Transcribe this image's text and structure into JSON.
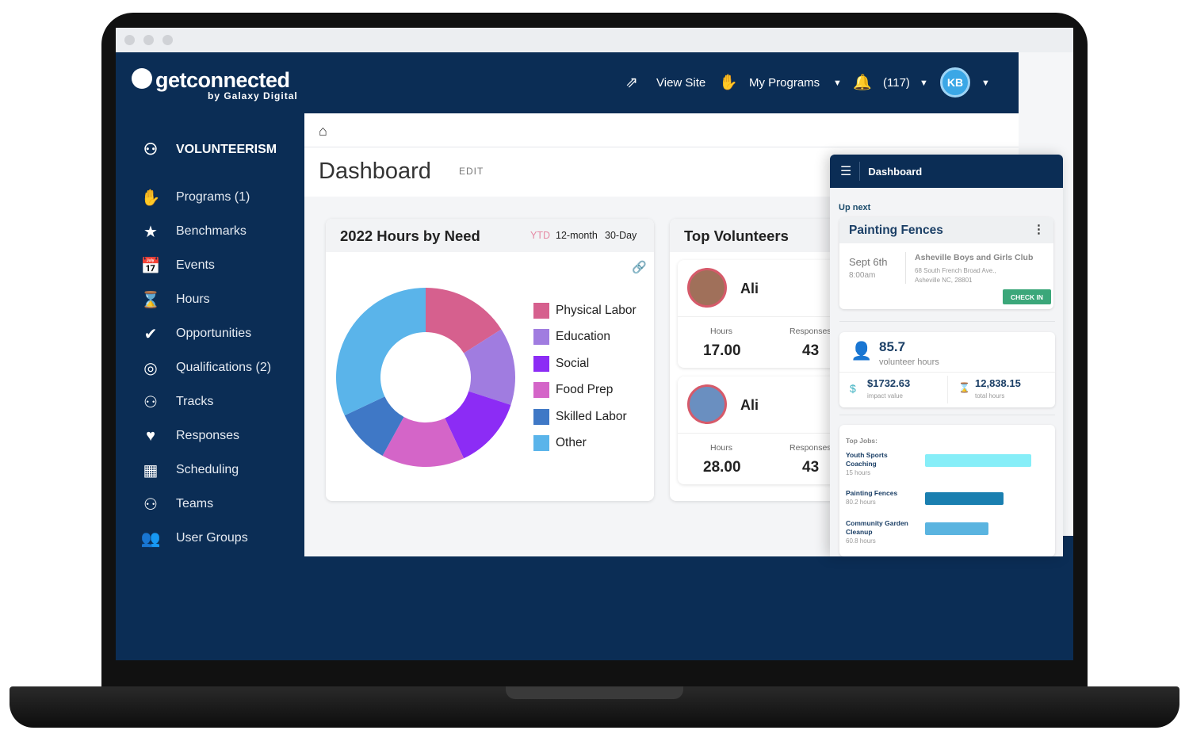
{
  "brand": {
    "name": "getconnected",
    "sub": "by Galaxy Digital"
  },
  "header": {
    "view_site": "View Site",
    "my_programs": "My Programs",
    "notification_count": "(117)",
    "avatar_initials": "KB"
  },
  "sidebar": {
    "section": "VOLUNTEERISM",
    "items": [
      {
        "label": "Programs (1)",
        "icon": "hand-globe-icon"
      },
      {
        "label": "Benchmarks",
        "icon": "star-icon"
      },
      {
        "label": "Events",
        "icon": "calendar-icon"
      },
      {
        "label": "Hours",
        "icon": "hourglass-icon"
      },
      {
        "label": "Opportunities",
        "icon": "check-circle-icon"
      },
      {
        "label": "Qualifications (2)",
        "icon": "target-icon"
      },
      {
        "label": "Tracks",
        "icon": "people-icon"
      },
      {
        "label": "Responses",
        "icon": "heart-hands-icon"
      },
      {
        "label": "Scheduling",
        "icon": "calendar-grid-icon"
      },
      {
        "label": "Teams",
        "icon": "team-icon"
      },
      {
        "label": "User Groups",
        "icon": "users-icon"
      }
    ]
  },
  "page": {
    "title": "Dashboard",
    "edit": "EDIT"
  },
  "hours_card": {
    "title": "2022 Hours by Need",
    "filters": [
      "YTD",
      "12-month",
      "30-Day"
    ],
    "active_filter": "YTD"
  },
  "chart_data": {
    "type": "pie",
    "title": "2022 Hours by Need",
    "donut": true,
    "legend": "right",
    "categories": [
      "Physical Labor",
      "Education",
      "Social",
      "Food Prep",
      "Skilled Labor",
      "Other"
    ],
    "values": [
      16,
      14,
      13,
      15,
      10,
      32
    ],
    "colors": [
      "#d6608e",
      "#a07ce0",
      "#8c2cf5",
      "#d465c8",
      "#3f78c6",
      "#5ab4ea"
    ]
  },
  "top_volunteers": {
    "title": "Top Volunteers",
    "items": [
      {
        "name": "Ali",
        "hours_label": "Hours",
        "hours": "17.00",
        "responses_label": "Responses",
        "responses": "43"
      },
      {
        "name": "Ali",
        "hours_label": "Hours",
        "hours": "28.00",
        "responses_label": "Responses",
        "responses": "43"
      }
    ]
  },
  "mobile": {
    "title": "Dashboard",
    "up_next": "Up next",
    "event": {
      "title": "Painting Fences",
      "date": "Sept 6th",
      "time": "8:00am",
      "org": "Asheville Boys and Girls Club",
      "address1": "68 South French Broad Ave.,",
      "address2": "Asheville NC, 28801",
      "check_in": "CHECK IN"
    },
    "stats": {
      "volunteer_hours": "85.7",
      "volunteer_hours_label": "volunteer hours",
      "impact": "$1732.63",
      "impact_label": "impact value",
      "total": "12,838.15",
      "total_label": "total hours"
    },
    "top_jobs": {
      "label": "Top Jobs:",
      "items": [
        {
          "name": "Youth Sports Coaching",
          "hours": "15 hours",
          "fill": 0.92,
          "color": "#86eef8"
        },
        {
          "name": "Painting Fences",
          "hours": "80.2 hours",
          "fill": 0.68,
          "color": "#1a7fb0"
        },
        {
          "name": "Community Garden Cleanup",
          "hours": "60.8 hours",
          "fill": 0.55,
          "color": "#5ab4e0"
        }
      ]
    }
  }
}
